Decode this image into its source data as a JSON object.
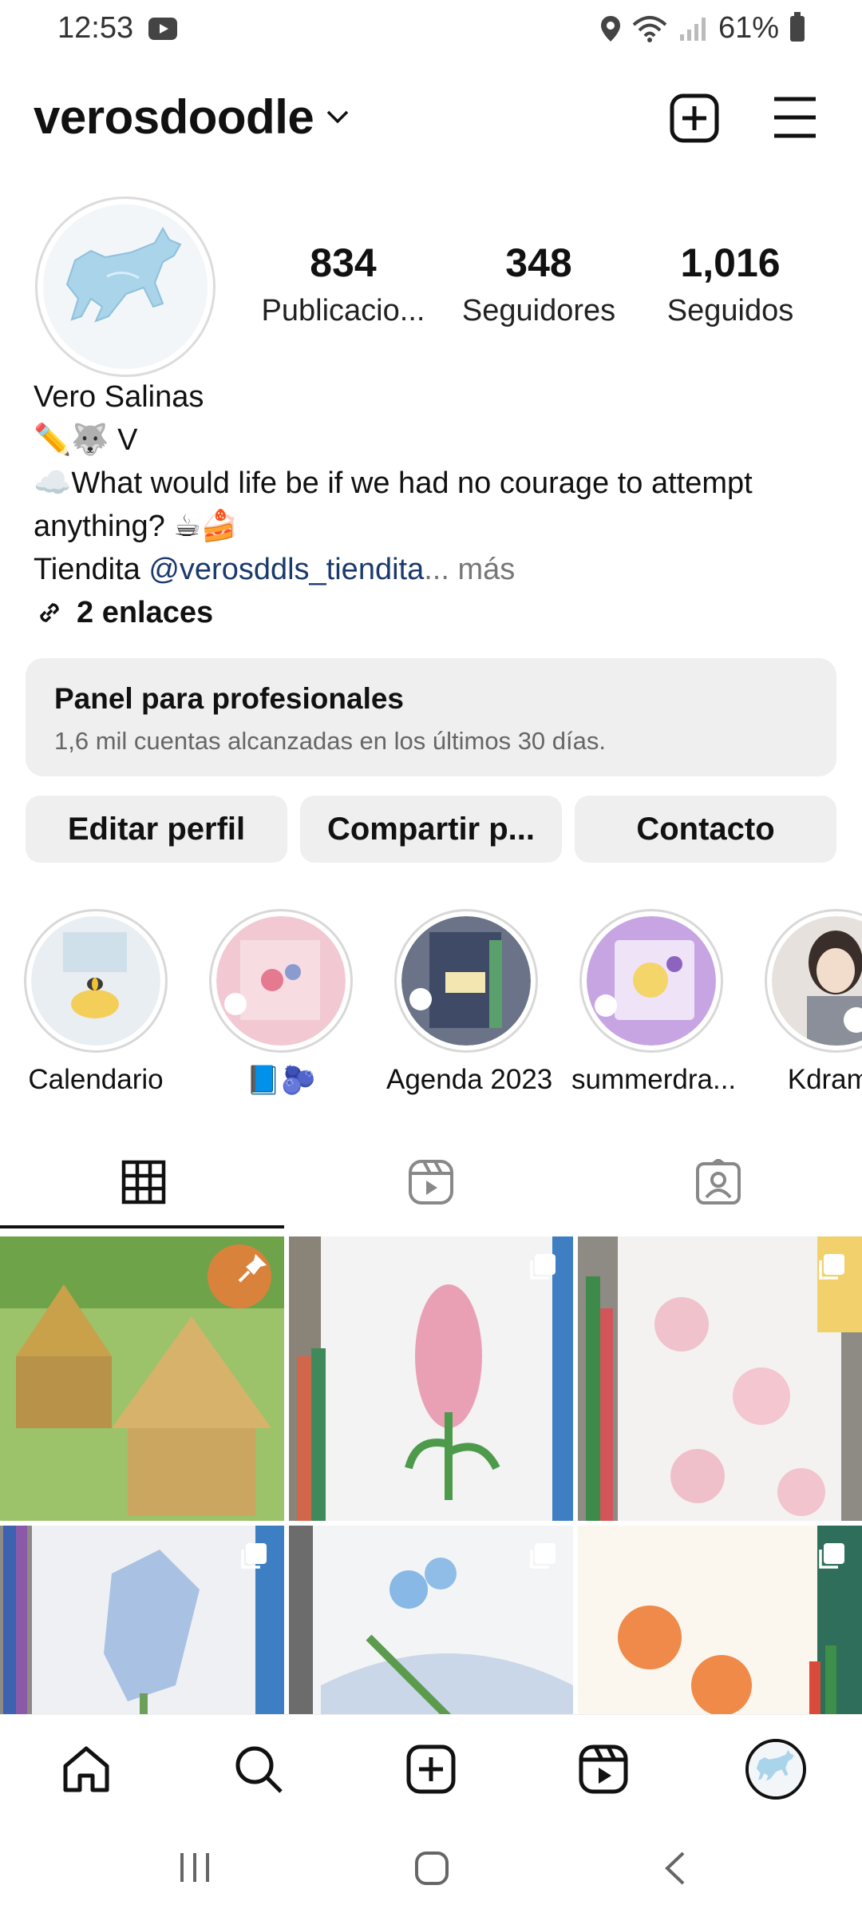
{
  "status_bar": {
    "time": "12:53",
    "battery": "61%"
  },
  "header": {
    "username": "verosdoodle"
  },
  "profile": {
    "stats": [
      {
        "value": "834",
        "label": "Publicacio..."
      },
      {
        "value": "348",
        "label": "Seguidores"
      },
      {
        "value": "1,016",
        "label": "Seguidos"
      }
    ],
    "name": "Vero Salinas",
    "bio_line1": "✏️🐺 V",
    "bio_line2": "☁️What would life be if we had no courage to attempt",
    "bio_line3": "anything? ☕🍰",
    "bio_line4_prefix": "Tiendita ",
    "bio_line4_mention": "@verosddls_tiendita",
    "bio_line4_ellipsis": "...",
    "bio_more": " más",
    "links_label": "2 enlaces"
  },
  "panel": {
    "title": "Panel para profesionales",
    "subtitle": "1,6 mil cuentas alcanzadas en los últimos 30 días."
  },
  "buttons": {
    "edit": "Editar perfil",
    "share": "Compartir p...",
    "contact": "Contacto"
  },
  "highlights": [
    {
      "label": "Calendario"
    },
    {
      "label": "📘🫐"
    },
    {
      "label": "Agenda 2023"
    },
    {
      "label": "summerdra..."
    },
    {
      "label": "Kdrama"
    }
  ],
  "tabs": [
    {
      "icon": "grid-icon",
      "active": true
    },
    {
      "icon": "reels-icon",
      "active": false
    },
    {
      "icon": "tagged-icon",
      "active": false
    }
  ],
  "colors": {
    "mention": "#1a3a6e",
    "panel_bg": "#efefef",
    "text": "#111111"
  }
}
